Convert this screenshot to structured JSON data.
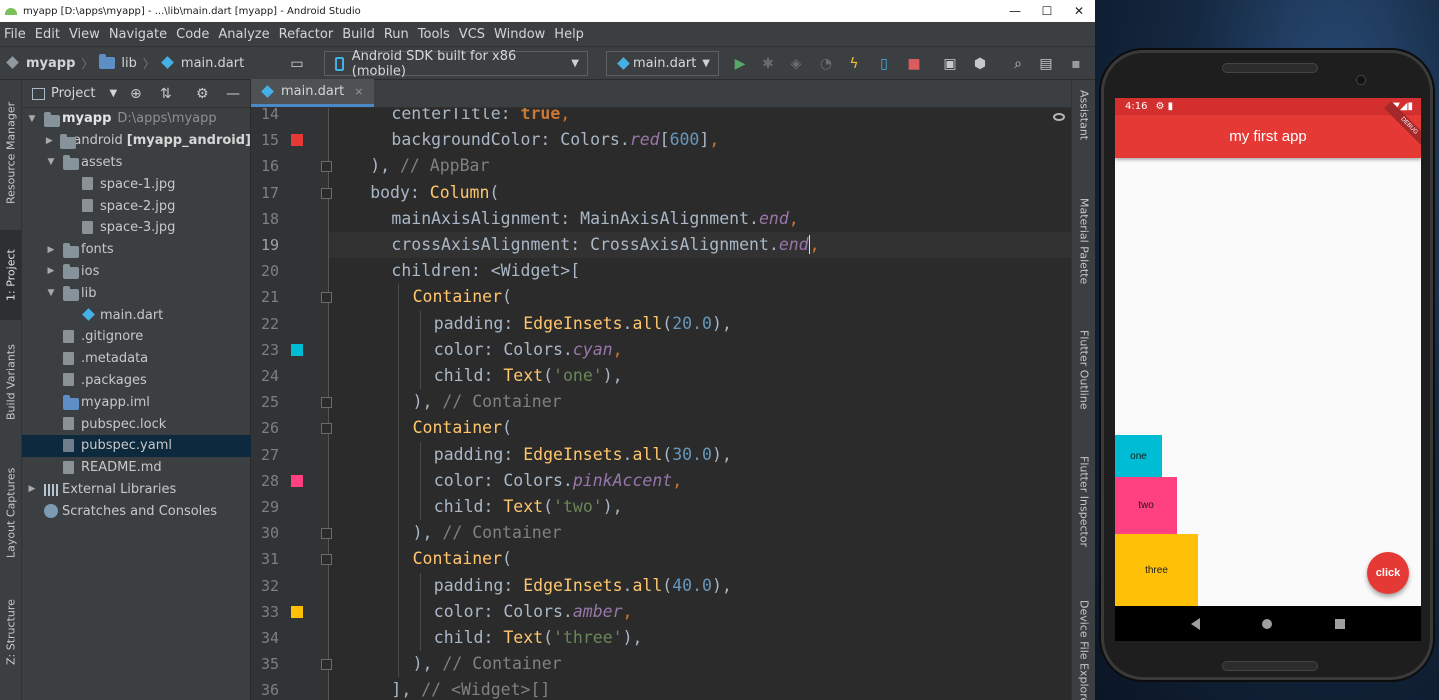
{
  "window": {
    "title": "myapp [D:\\apps\\myapp] - ...\\lib\\main.dart [myapp] - Android Studio",
    "minimize": "—",
    "maximize": "☐",
    "close": "✕"
  },
  "menu": [
    "File",
    "Edit",
    "View",
    "Navigate",
    "Code",
    "Analyze",
    "Refactor",
    "Build",
    "Run",
    "Tools",
    "VCS",
    "Window",
    "Help"
  ],
  "breadcrumbs": {
    "project": "myapp",
    "folder": "lib",
    "file": "main.dart",
    "separator": "〉"
  },
  "toolbar": {
    "device": "Android SDK built for x86 (mobile)",
    "run_config": "main.dart",
    "caret": "▼"
  },
  "left_tools": [
    "Resource Manager",
    "1: Project",
    "Build Variants",
    "Layout Captures",
    "Z: Structure"
  ],
  "right_tools": [
    "Assistant",
    "Material Palette",
    "Flutter Outline",
    "Flutter Inspector",
    "Device File Explorer"
  ],
  "project_panel": {
    "title": "Project",
    "caret": "▼",
    "tree": [
      {
        "label": "myapp",
        "extra": "D:\\apps\\myapp",
        "depth": 0,
        "arrow": "▼",
        "icon": "folder"
      },
      {
        "label": "android",
        "extra": "[myapp_android]",
        "depth": 1,
        "arrow": "▶",
        "icon": "folder"
      },
      {
        "label": "assets",
        "depth": 1,
        "arrow": "▼",
        "icon": "folder"
      },
      {
        "label": "space-1.jpg",
        "depth": 2,
        "arrow": "",
        "icon": "image"
      },
      {
        "label": "space-2.jpg",
        "depth": 2,
        "arrow": "",
        "icon": "image"
      },
      {
        "label": "space-3.jpg",
        "depth": 2,
        "arrow": "",
        "icon": "image"
      },
      {
        "label": "fonts",
        "depth": 1,
        "arrow": "▶",
        "icon": "folder"
      },
      {
        "label": "ios",
        "depth": 1,
        "arrow": "▶",
        "icon": "folder"
      },
      {
        "label": "lib",
        "depth": 1,
        "arrow": "▼",
        "icon": "folder"
      },
      {
        "label": "main.dart",
        "depth": 2,
        "arrow": "",
        "icon": "dart"
      },
      {
        "label": ".gitignore",
        "depth": 1,
        "arrow": "",
        "icon": "file"
      },
      {
        "label": ".metadata",
        "depth": 1,
        "arrow": "",
        "icon": "file"
      },
      {
        "label": ".packages",
        "depth": 1,
        "arrow": "",
        "icon": "file"
      },
      {
        "label": "myapp.iml",
        "depth": 1,
        "arrow": "",
        "icon": "iml"
      },
      {
        "label": "pubspec.lock",
        "depth": 1,
        "arrow": "",
        "icon": "file"
      },
      {
        "label": "pubspec.yaml",
        "depth": 1,
        "arrow": "",
        "icon": "yaml",
        "selected": true
      },
      {
        "label": "README.md",
        "depth": 1,
        "arrow": "",
        "icon": "file"
      },
      {
        "label": "External Libraries",
        "depth": 0,
        "arrow": "▶",
        "icon": "library"
      },
      {
        "label": "Scratches and Consoles",
        "depth": 0,
        "arrow": "",
        "icon": "scratch"
      }
    ]
  },
  "editor": {
    "tab": "main.dart",
    "tab_close": "×",
    "current_line": 19,
    "lines": [
      {
        "n": 14,
        "indent": 2,
        "tokens": [
          [
            "centerTitle: ",
            "p"
          ],
          [
            "true",
            "kw"
          ],
          [
            ",",
            "pu"
          ]
        ]
      },
      {
        "n": 15,
        "indent": 2,
        "swatch": "#e53935",
        "tokens": [
          [
            "backgroundColor: Colors.",
            "p"
          ],
          [
            "red",
            "it"
          ],
          [
            "[",
            "p"
          ],
          [
            "600",
            "num"
          ],
          [
            "]",
            "p"
          ],
          [
            ",",
            "pu"
          ]
        ]
      },
      {
        "n": 16,
        "indent": 1,
        "fold": true,
        "tokens": [
          [
            "), ",
            "p"
          ],
          [
            "// AppBar",
            "cm"
          ]
        ]
      },
      {
        "n": 17,
        "indent": 1,
        "fold": true,
        "tokens": [
          [
            "body: ",
            "p"
          ],
          [
            "Column",
            "cls"
          ],
          [
            "(",
            "p"
          ]
        ]
      },
      {
        "n": 18,
        "indent": 2,
        "tokens": [
          [
            "mainAxisAlignment: MainAxisAlignment.",
            "p"
          ],
          [
            "end",
            "it"
          ],
          [
            ",",
            "pu"
          ]
        ]
      },
      {
        "n": 19,
        "indent": 2,
        "tokens": [
          [
            "crossAxisAlignment: CrossAxisAlignment.",
            "p"
          ],
          [
            "end",
            "it"
          ],
          [
            "|",
            "p"
          ],
          [
            ",",
            "pu"
          ]
        ]
      },
      {
        "n": 20,
        "indent": 2,
        "tokens": [
          [
            "children: <Widget>[",
            "p"
          ]
        ]
      },
      {
        "n": 21,
        "indent": 3,
        "fold": true,
        "tokens": [
          [
            "Container",
            "cls"
          ],
          [
            "(",
            "p"
          ]
        ]
      },
      {
        "n": 22,
        "indent": 4,
        "tokens": [
          [
            "padding: ",
            "p"
          ],
          [
            "EdgeInsets",
            "cls"
          ],
          [
            ".",
            "p"
          ],
          [
            "all",
            "cls"
          ],
          [
            "(",
            "p"
          ],
          [
            "20.0",
            "num"
          ],
          [
            "),",
            "p"
          ]
        ]
      },
      {
        "n": 23,
        "indent": 4,
        "swatch": "#00bcd4",
        "tokens": [
          [
            "color: Colors.",
            "p"
          ],
          [
            "cyan",
            "it"
          ],
          [
            ",",
            "pu"
          ]
        ]
      },
      {
        "n": 24,
        "indent": 4,
        "tokens": [
          [
            "child: ",
            "p"
          ],
          [
            "Text",
            "cls"
          ],
          [
            "(",
            "p"
          ],
          [
            "'one'",
            "str"
          ],
          [
            "),",
            "p"
          ]
        ]
      },
      {
        "n": 25,
        "indent": 3,
        "fold": true,
        "tokens": [
          [
            "), ",
            "p"
          ],
          [
            "// Container",
            "cm"
          ]
        ]
      },
      {
        "n": 26,
        "indent": 3,
        "fold": true,
        "tokens": [
          [
            "Container",
            "cls"
          ],
          [
            "(",
            "p"
          ]
        ]
      },
      {
        "n": 27,
        "indent": 4,
        "tokens": [
          [
            "padding: ",
            "p"
          ],
          [
            "EdgeInsets",
            "cls"
          ],
          [
            ".",
            "p"
          ],
          [
            "all",
            "cls"
          ],
          [
            "(",
            "p"
          ],
          [
            "30.0",
            "num"
          ],
          [
            "),",
            "p"
          ]
        ]
      },
      {
        "n": 28,
        "indent": 4,
        "swatch": "#ff4081",
        "tokens": [
          [
            "color: Colors.",
            "p"
          ],
          [
            "pinkAccent",
            "it"
          ],
          [
            ",",
            "pu"
          ]
        ]
      },
      {
        "n": 29,
        "indent": 4,
        "tokens": [
          [
            "child: ",
            "p"
          ],
          [
            "Text",
            "cls"
          ],
          [
            "(",
            "p"
          ],
          [
            "'two'",
            "str"
          ],
          [
            "),",
            "p"
          ]
        ]
      },
      {
        "n": 30,
        "indent": 3,
        "fold": true,
        "tokens": [
          [
            "), ",
            "p"
          ],
          [
            "// Container",
            "cm"
          ]
        ]
      },
      {
        "n": 31,
        "indent": 3,
        "fold": true,
        "tokens": [
          [
            "Container",
            "cls"
          ],
          [
            "(",
            "p"
          ]
        ]
      },
      {
        "n": 32,
        "indent": 4,
        "tokens": [
          [
            "padding: ",
            "p"
          ],
          [
            "EdgeInsets",
            "cls"
          ],
          [
            ".",
            "p"
          ],
          [
            "all",
            "cls"
          ],
          [
            "(",
            "p"
          ],
          [
            "40.0",
            "num"
          ],
          [
            "),",
            "p"
          ]
        ]
      },
      {
        "n": 33,
        "indent": 4,
        "swatch": "#ffc107",
        "tokens": [
          [
            "color: Colors.",
            "p"
          ],
          [
            "amber",
            "it"
          ],
          [
            ",",
            "pu"
          ]
        ]
      },
      {
        "n": 34,
        "indent": 4,
        "tokens": [
          [
            "child: ",
            "p"
          ],
          [
            "Text",
            "cls"
          ],
          [
            "(",
            "p"
          ],
          [
            "'three'",
            "str"
          ],
          [
            "),",
            "p"
          ]
        ]
      },
      {
        "n": 35,
        "indent": 3,
        "fold": true,
        "tokens": [
          [
            "), ",
            "p"
          ],
          [
            "// Container",
            "cm"
          ]
        ]
      },
      {
        "n": 36,
        "indent": 2,
        "tokens": [
          [
            "], ",
            "p"
          ],
          [
            "// <Widget>[]",
            "cm"
          ]
        ]
      }
    ]
  },
  "emulator": {
    "time": "4:16",
    "app_title": "my first app",
    "debug_label": "DEBUG",
    "boxes": [
      {
        "text": "one",
        "color": "#00bcd4"
      },
      {
        "text": "two",
        "color": "#ff4081"
      },
      {
        "text": "three",
        "color": "#ffc107"
      }
    ],
    "fab_label": "click",
    "status_icons": "▼◢▮",
    "status_left_icons": "⚙ ▮"
  },
  "colors": {
    "accent": "#4a88c7",
    "appbar": "#e53935",
    "statusbar": "#d32f2f"
  }
}
